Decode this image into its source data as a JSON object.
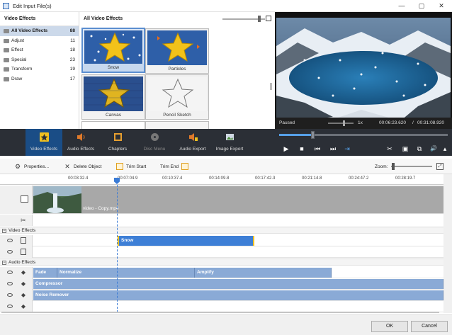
{
  "window": {
    "title": "Edit Input File(s)",
    "controls": [
      "—",
      "▢",
      "✕"
    ]
  },
  "categories": {
    "header": "Video Effects",
    "items": [
      {
        "label": "All Video Effects",
        "count": "88",
        "selected": true
      },
      {
        "label": "Adjust",
        "count": "11"
      },
      {
        "label": "Effect",
        "count": "18"
      },
      {
        "label": "Special",
        "count": "23"
      },
      {
        "label": "Transform",
        "count": "19"
      },
      {
        "label": "Draw",
        "count": "17"
      }
    ]
  },
  "gallery": {
    "header": "All Video Effects",
    "items": [
      {
        "label": "Snow",
        "selected": true
      },
      {
        "label": "Particles"
      },
      {
        "label": "Canvas"
      },
      {
        "label": "Pencil Sketch"
      }
    ]
  },
  "preview": {
    "state": "Paused",
    "speed": "1x",
    "current_time": "00:06:23.620",
    "separator": "/",
    "total_time": "00:31:08.920",
    "seek_fraction": 0.2
  },
  "main_toolbar": {
    "items": [
      {
        "label": "Video Effects",
        "icon": "star-icon",
        "active": true
      },
      {
        "label": "Audio Effects",
        "icon": "speaker-icon"
      },
      {
        "label": "Chapters",
        "icon": "chapters-icon"
      },
      {
        "label": "Disc Menu",
        "icon": "disc-icon",
        "disabled": true
      },
      {
        "label": "Audio Export",
        "icon": "audio-export-icon"
      },
      {
        "label": "Image Export",
        "icon": "image-export-icon"
      }
    ]
  },
  "transport": {
    "buttons": [
      "▶",
      "■",
      "⏮",
      "⏭",
      "⇥"
    ],
    "right_buttons": [
      "✂",
      "▣",
      "⧉",
      "🔊",
      "▴"
    ]
  },
  "edit_toolbar": {
    "properties": "Properties...",
    "delete": "Delete Object",
    "trim_start": "Trim Start",
    "trim_end": "Trim End",
    "zoom": "Zoom:"
  },
  "ruler": {
    "ticks": [
      "00:03:32.4",
      "00:07:04.9",
      "00:10:37.4",
      "00:14:09.8",
      "00:17:42.3",
      "00:21:14.8",
      "00:24:47.2",
      "00:28:19.7"
    ]
  },
  "video_track": {
    "clip_name": "video - Copy.mp4"
  },
  "sections": {
    "video": "Video Effects",
    "audio": "Audio Effects"
  },
  "video_effects": [
    {
      "label": "Snow"
    }
  ],
  "audio_effects": {
    "lane1": [
      "Fade",
      "Normalize",
      "Amplify"
    ],
    "lane2": [
      "Compressor"
    ],
    "lane3": [
      "Noise Remover"
    ]
  },
  "footer": {
    "ok": "OK",
    "cancel": "Cancel"
  }
}
